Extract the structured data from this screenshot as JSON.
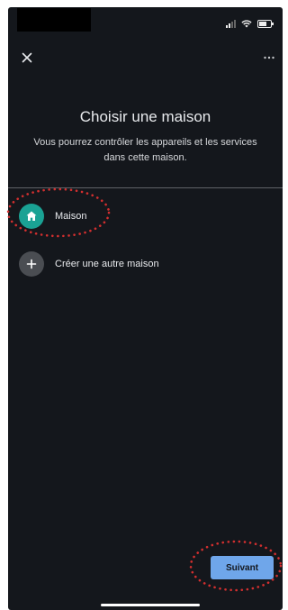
{
  "header": {
    "title": "Choisir une maison",
    "subtitle": "Vous pourrez contrôler les appareils et les services dans cette maison."
  },
  "homes": {
    "items": [
      {
        "label": "Maison",
        "icon": "home-icon"
      },
      {
        "label": "Créer une autre maison",
        "icon": "plus-icon"
      }
    ]
  },
  "footer": {
    "next_label": "Suivant"
  },
  "colors": {
    "background": "#14171c",
    "accent_teal": "#1aa294",
    "button_blue": "#6fa6ea",
    "annotation_red": "#d32f2f"
  }
}
